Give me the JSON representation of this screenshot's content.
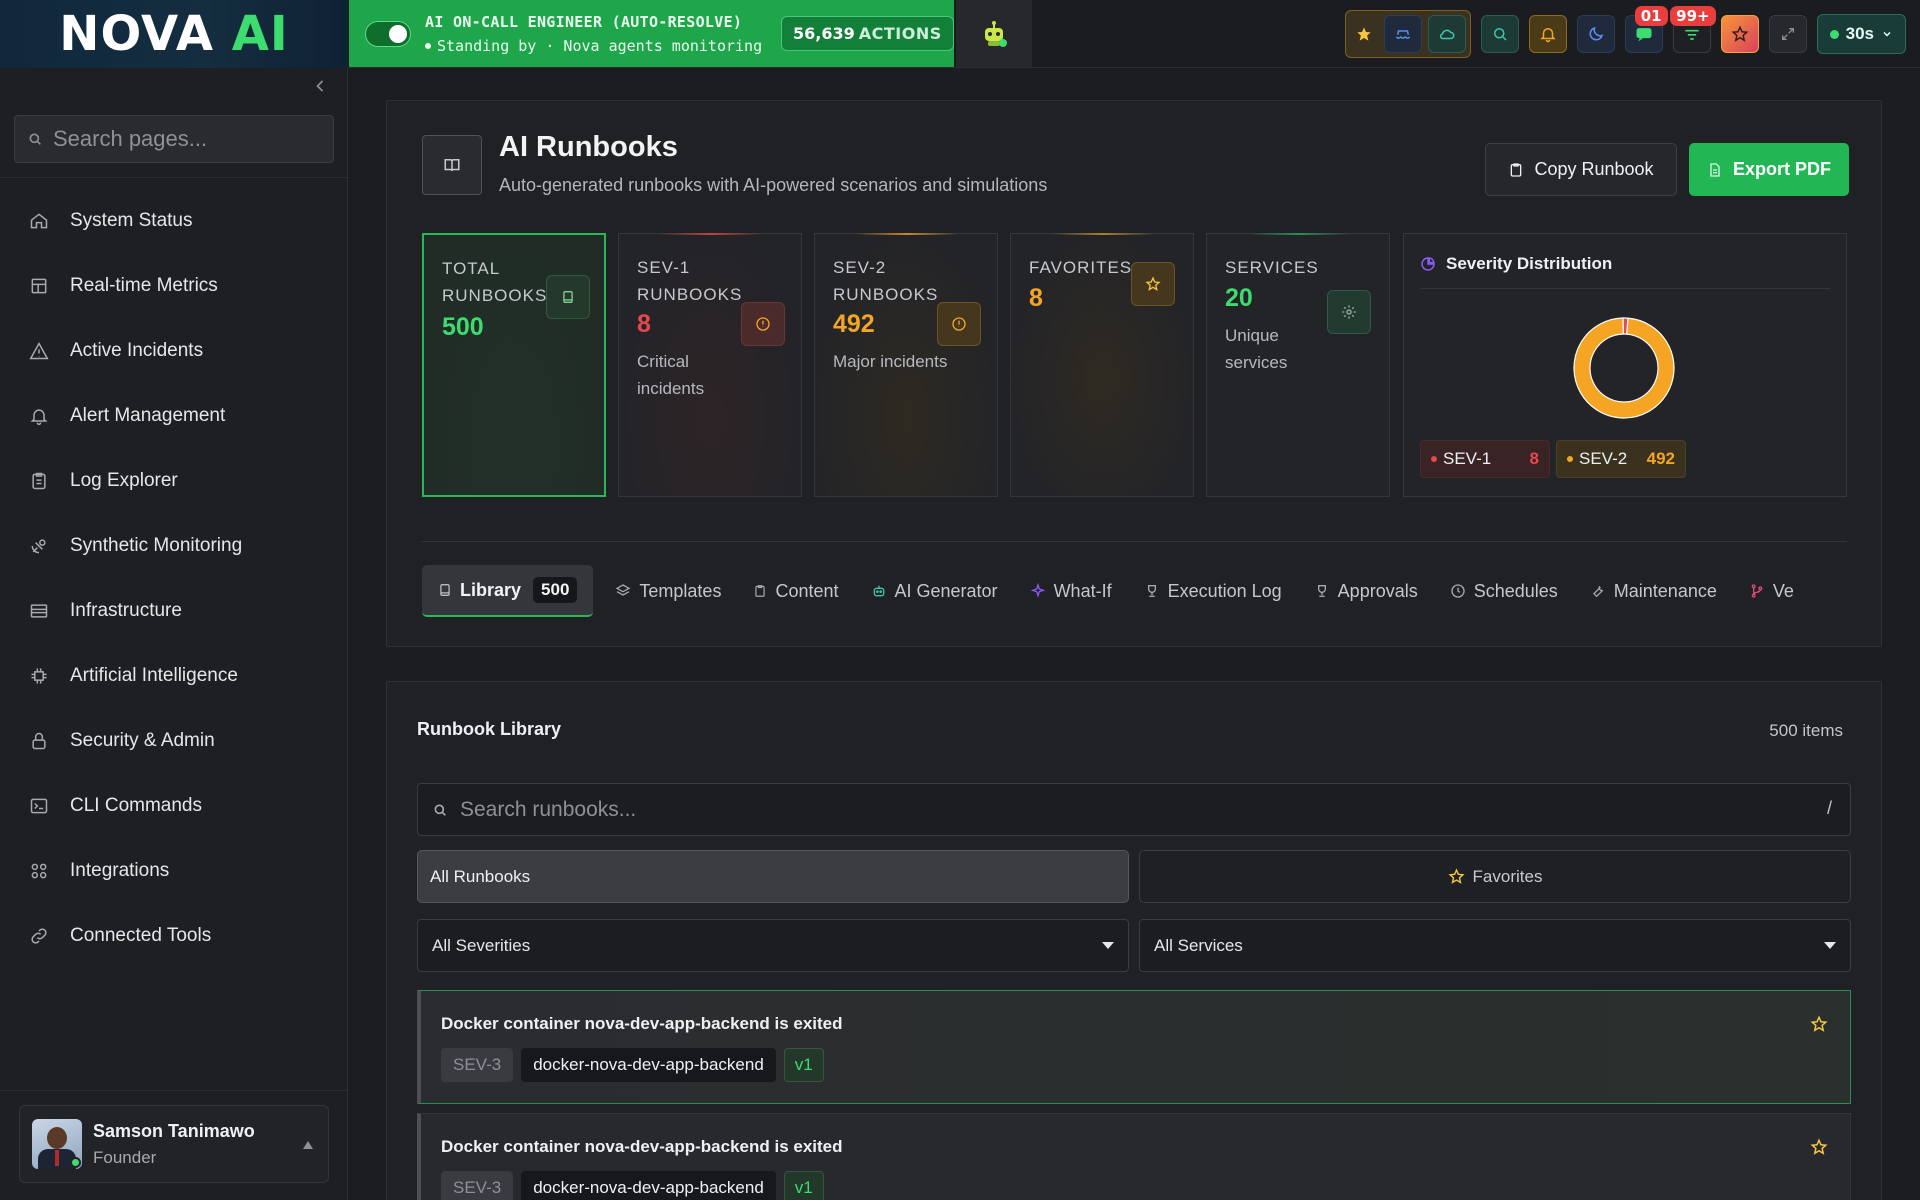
{
  "brand": {
    "name_main": "NOVA",
    "name_accent": "AI"
  },
  "oncall": {
    "title": "AI ON-CALL ENGINEER (AUTO-RESOLVE)",
    "status": "Standing by · Nova agents monitoring",
    "actions_count": "56,639",
    "actions_label": "ACTIONS",
    "enabled": true
  },
  "topbar": {
    "badge_messages": "01",
    "badge_alerts": "99+",
    "refresh_interval": "30s",
    "icons": [
      "robot-icon",
      "star-icon",
      "cloud-ship-icon",
      "cloud-icon",
      "search-icon",
      "bell-icon",
      "moon-icon",
      "chat-icon",
      "filter-icon",
      "star-gradient-icon",
      "expand-icon"
    ]
  },
  "sidebar": {
    "search_placeholder": "Search pages...",
    "items": [
      {
        "label": "System Status",
        "icon": "home-icon"
      },
      {
        "label": "Real-time Metrics",
        "icon": "layout-icon"
      },
      {
        "label": "Active Incidents",
        "icon": "warning-icon"
      },
      {
        "label": "Alert Management",
        "icon": "bell-icon"
      },
      {
        "label": "Log Explorer",
        "icon": "clipboard-icon"
      },
      {
        "label": "Synthetic Monitoring",
        "icon": "satellite-icon"
      },
      {
        "label": "Infrastructure",
        "icon": "server-icon"
      },
      {
        "label": "Artificial Intelligence",
        "icon": "cpu-icon"
      },
      {
        "label": "Security & Admin",
        "icon": "lock-icon"
      },
      {
        "label": "CLI Commands",
        "icon": "terminal-icon"
      },
      {
        "label": "Integrations",
        "icon": "grid-icon"
      },
      {
        "label": "Connected Tools",
        "icon": "link-icon"
      }
    ],
    "user": {
      "name": "Samson Tanimawo",
      "role": "Founder"
    }
  },
  "header": {
    "title": "AI Runbooks",
    "subtitle": "Auto-generated runbooks with AI-powered scenarios and simulations",
    "copy_label": "Copy Runbook",
    "export_label": "Export PDF"
  },
  "stats": {
    "total": {
      "label": "TOTAL RUNBOOKS",
      "value": "500"
    },
    "sev1": {
      "label": "SEV-1 RUNBOOKS",
      "value": "8",
      "desc": "Critical incidents"
    },
    "sev2": {
      "label": "SEV-2 RUNBOOKS",
      "value": "492",
      "desc": "Major incidents"
    },
    "favorites": {
      "label": "FAVORITES",
      "value": "8"
    },
    "services": {
      "label": "SERVICES",
      "value": "20",
      "desc": "Unique services"
    }
  },
  "severity_distribution": {
    "title": "Severity Distribution",
    "legend": [
      {
        "label": "SEV-1",
        "value": "8",
        "color": "#e5484d"
      },
      {
        "label": "SEV-2",
        "value": "492",
        "color": "#f5a524"
      }
    ]
  },
  "chart_data": {
    "type": "pie",
    "title": "Severity Distribution",
    "categories": [
      "SEV-1",
      "SEV-2"
    ],
    "values": [
      8,
      492
    ],
    "colors": [
      "#e5484d",
      "#f5a524"
    ],
    "donut": true
  },
  "tabs": [
    {
      "label": "Library",
      "count": "500",
      "icon": "book-icon",
      "active": true
    },
    {
      "label": "Templates",
      "icon": "layers-icon"
    },
    {
      "label": "Content",
      "icon": "clipboard-icon"
    },
    {
      "label": "AI Generator",
      "icon": "robot-icon"
    },
    {
      "label": "What-If",
      "icon": "sparkle-icon"
    },
    {
      "label": "Execution Log",
      "icon": "trophy-icon"
    },
    {
      "label": "Approvals",
      "icon": "trophy-icon"
    },
    {
      "label": "Schedules",
      "icon": "clock-icon"
    },
    {
      "label": "Maintenance",
      "icon": "wrench-icon"
    },
    {
      "label": "Ve",
      "icon": "branch-icon"
    }
  ],
  "library": {
    "title": "Runbook Library",
    "count_label": "500 items",
    "search_placeholder": "Search runbooks...",
    "search_shortcut": "/",
    "filter_all": "All Runbooks",
    "filter_favorites": "Favorites",
    "severity_select": "All Severities",
    "service_select": "All Services",
    "items": [
      {
        "title": "Docker container nova-dev-app-backend is exited",
        "severity": "SEV-3",
        "service": "docker-nova-dev-app-backend",
        "version": "v1"
      },
      {
        "title": "Docker container nova-dev-app-backend is exited",
        "severity": "SEV-3",
        "service": "docker-nova-dev-app-backend",
        "version": "v1"
      }
    ]
  }
}
